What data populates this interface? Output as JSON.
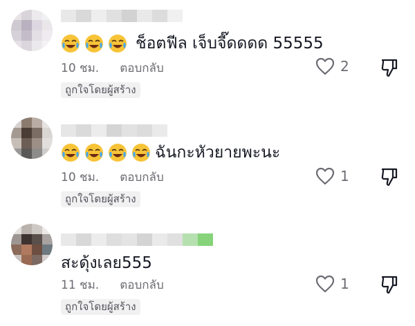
{
  "comments": [
    {
      "text": "ช็อตฟีล เจ็บจี๊ดดดด 55555",
      "emoji_count": 3,
      "time": "10 ชม.",
      "reply": "ตอบกลับ",
      "likes": "2",
      "badge": "ถูกใจโดยผู้สร้าง"
    },
    {
      "text": "ฉันกะหัวยายพะนะ",
      "emoji_count": 4,
      "time": "10 ชม.",
      "reply": "ตอบกลับ",
      "likes": "1",
      "badge": "ถูกใจโดยผู้สร้าง"
    },
    {
      "text": "สะดุ้งเลย555",
      "emoji_count": 0,
      "time": "11 ชม.",
      "reply": "ตอบกลับ",
      "likes": "1",
      "badge": "ถูกใจโดยผู้สร้าง"
    }
  ],
  "icons": {
    "emoji": "face-with-tears-of-joy-icon",
    "like": "heart-outline-icon",
    "dislike": "thumbs-down-icon"
  },
  "colors": {
    "text": "#161823",
    "muted": "#6b6b72",
    "badge_bg": "#f1f1f2",
    "emoji_yellow": "#f7c438",
    "emoji_tear": "#4aa8e8"
  }
}
